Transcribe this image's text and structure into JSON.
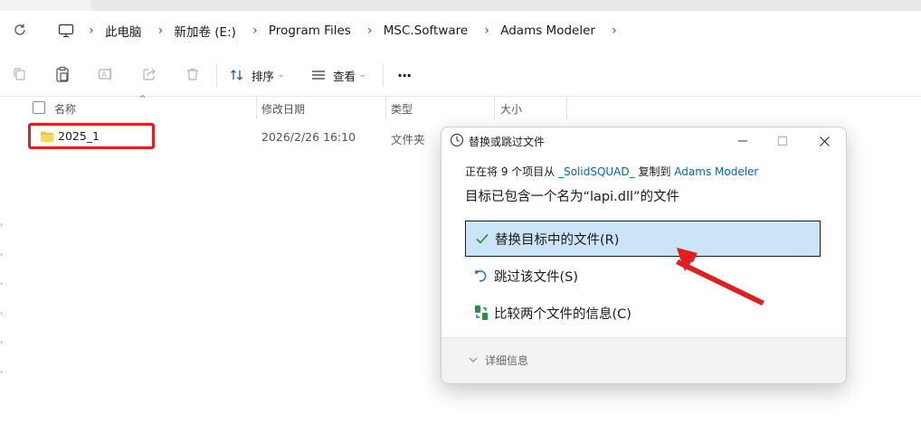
{
  "breadcrumb": [
    "此电脑",
    "新加卷 (E:)",
    "Program Files",
    "MSC.Software",
    "Adams Modeler"
  ],
  "toolbar": {
    "sort_label": "排序",
    "view_label": "查看",
    "more_label": "···"
  },
  "columns": {
    "name": "名称",
    "date": "修改日期",
    "type": "类型",
    "size": "大小"
  },
  "files": [
    {
      "name": "2025_1",
      "date": "2026/2/26 16:10",
      "type": "文件夹"
    }
  ],
  "dialog": {
    "title": "替换或跳过文件",
    "msg_prefix": "正在将 9 个项目从 ",
    "source": "_SolidSQUAD_",
    "msg_mid": " 复制到 ",
    "dest": "Adams Modeler",
    "heading": "目标已包含一个名为“lapi.dll”的文件",
    "options": {
      "replace": "替换目标中的文件(R)",
      "skip": "跳过该文件(S)",
      "compare": "比较两个文件的信息(C)"
    },
    "more_details": "详细信息"
  },
  "colors": {
    "highlight_box": "#e02020",
    "arrow": "#e02020",
    "selected_option_bg": "#cce4f7",
    "link": "#0067c0"
  }
}
